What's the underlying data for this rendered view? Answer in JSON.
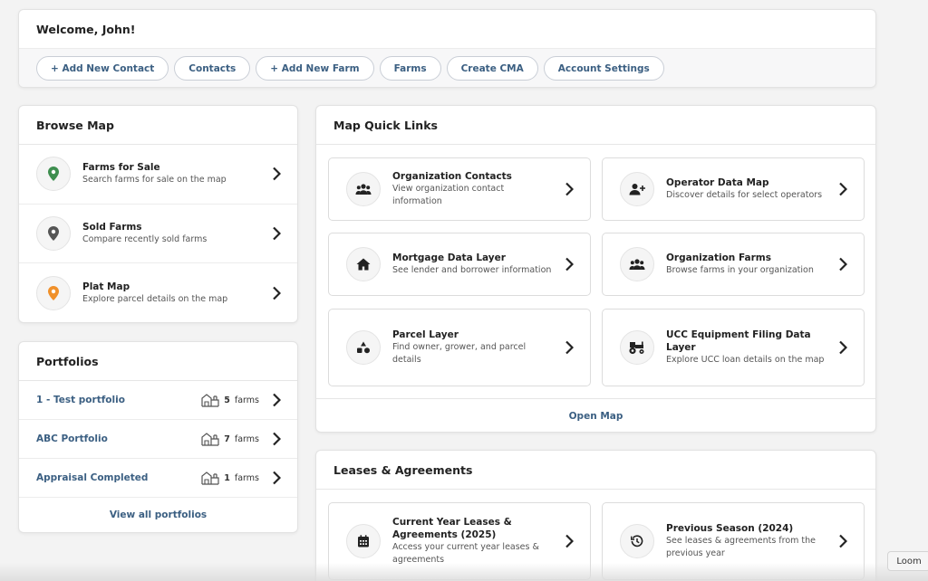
{
  "welcome": {
    "title": "Welcome, John!",
    "buttons": [
      {
        "label": "+ Add New Contact"
      },
      {
        "label": "Contacts"
      },
      {
        "label": "+ Add New Farm"
      },
      {
        "label": "Farms"
      },
      {
        "label": "Create CMA"
      },
      {
        "label": "Account Settings"
      }
    ]
  },
  "browse_map": {
    "title": "Browse Map",
    "items": [
      {
        "title": "Farms for Sale",
        "subtitle": "Search farms for sale on the map",
        "icon": "map-pin-icon",
        "icon_color": "#3e8e4f"
      },
      {
        "title": "Sold Farms",
        "subtitle": "Compare recently sold farms",
        "icon": "map-pin-icon",
        "icon_color": "#555555"
      },
      {
        "title": "Plat Map",
        "subtitle": "Explore parcel details on the map",
        "icon": "map-pin-icon",
        "icon_color": "#f0902a"
      }
    ]
  },
  "portfolios": {
    "title": "Portfolios",
    "items": [
      {
        "name": "1 - Test portfolio",
        "count": "5",
        "unit": "farms"
      },
      {
        "name": "ABC Portfolio",
        "count": "7",
        "unit": "farms"
      },
      {
        "name": "Appraisal Completed",
        "count": "1",
        "unit": "farms"
      }
    ],
    "view_all": "View all portfolios"
  },
  "quick_links": {
    "title": "Map Quick Links",
    "items": [
      {
        "title": "Organization Contacts",
        "subtitle": "View organization contact information",
        "icon": "users-icon"
      },
      {
        "title": "Operator Data Map",
        "subtitle": "Discover details for select operators",
        "icon": "user-plus-icon"
      },
      {
        "title": "Mortgage Data Layer",
        "subtitle": "See lender and borrower information",
        "icon": "home-icon"
      },
      {
        "title": "Organization Farms",
        "subtitle": "Browse farms in your organization",
        "icon": "users-icon"
      },
      {
        "title": "Parcel Layer",
        "subtitle": "Find owner, grower, and parcel details",
        "icon": "shapes-icon"
      },
      {
        "title": "UCC Equipment Filing Data Layer",
        "subtitle": "Explore UCC loan details on the map",
        "icon": "tractor-icon"
      }
    ],
    "open_map": "Open Map"
  },
  "leases": {
    "title": "Leases & Agreements",
    "items": [
      {
        "title": "Current Year Leases & Agreements (2025)",
        "subtitle": "Access your current year leases & agreements",
        "icon": "calendar-icon"
      },
      {
        "title": "Previous Season (2024)",
        "subtitle": "See leases & agreements from the previous year",
        "icon": "history-icon"
      }
    ]
  },
  "loom": {
    "label": "Loom"
  }
}
